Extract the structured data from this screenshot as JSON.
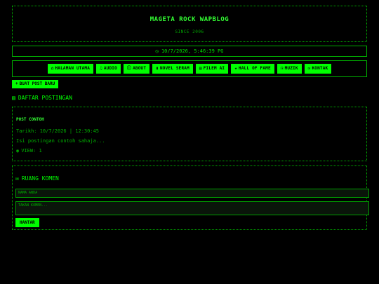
{
  "header": {
    "title": "MAGETA ROCK WAPBLOG",
    "subtitle": "SINCE 2006"
  },
  "clock": {
    "icon": "clock-icon",
    "text": "10/7/2026, 5:46:39 PG"
  },
  "nav": [
    {
      "label": "HALAMAN UTAMA",
      "icon": "home-icon"
    },
    {
      "label": "AUDIO",
      "icon": "music-icon"
    },
    {
      "label": "ABOUT",
      "icon": "info-icon"
    },
    {
      "label": "NOVEL SERAM",
      "icon": "book-icon"
    },
    {
      "label": "FILEM AI",
      "icon": "film-icon"
    },
    {
      "label": "HALL OF FAME",
      "icon": "trophy-icon"
    },
    {
      "label": "MUZIK",
      "icon": "headphones-icon"
    },
    {
      "label": "KONTAK",
      "icon": "envelope-icon"
    }
  ],
  "new_post": {
    "label": "BUAT POST BARU",
    "icon": "plus-icon"
  },
  "posts_section": {
    "title": "DAFTAR POSTINGAN",
    "icon": "table-icon"
  },
  "post": {
    "title": "POST CONTOH",
    "date": "Tarikh: 10/7/2026 | 12:30:45",
    "body": "Isi postingan contoh sahaja...",
    "views": "VIEW: 1",
    "views_icon": "eye-icon"
  },
  "comments": {
    "title": "RUANG KOMEN",
    "icon": "comments-icon",
    "name_placeholder": "NAMA ANDA",
    "comment_placeholder": "TAKAN KOMEN...",
    "send_label": "HANTAR"
  },
  "colors": {
    "accent": "#00ff00",
    "background": "#000000",
    "border": "#00b000"
  }
}
